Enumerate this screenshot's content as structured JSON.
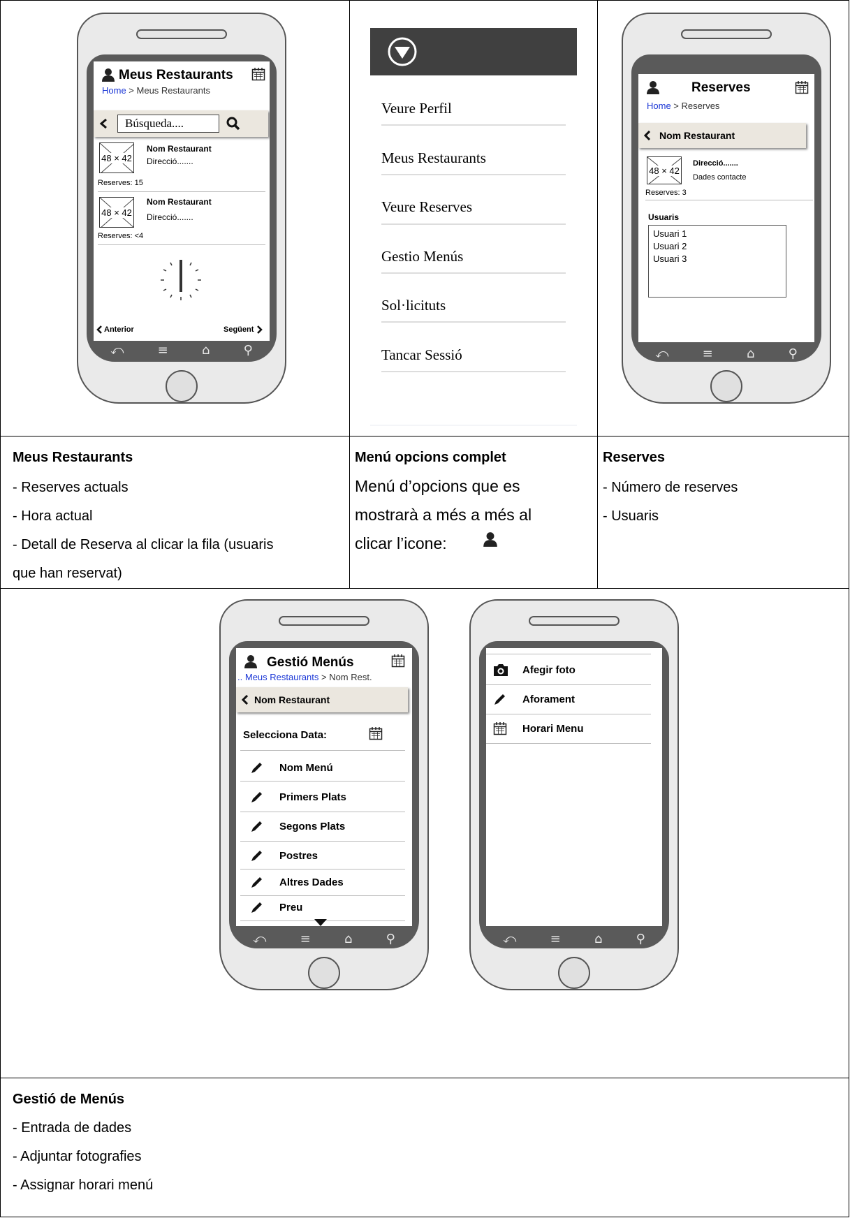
{
  "panel1": {
    "title": "Meus Restaurants",
    "crumb_home": "Home",
    "crumb_sep": " > ",
    "crumb_current": "Meus Restaurants",
    "search_value": "Búsqueda....",
    "items": [
      {
        "name": "Nom Restaurant",
        "addr": "Direcció.......",
        "img": "48 × 42",
        "reserves": "Reserves: 15"
      },
      {
        "name": "Nom Restaurant",
        "addr": "Direcció.......",
        "img": "48 × 42",
        "reserves": "Reserves: <4"
      }
    ],
    "prev_label": "Anterior",
    "next_label": "Següent"
  },
  "panel2": {
    "items": [
      "Veure Perfil",
      "Meus Restaurants",
      "Veure Reserves",
      "Gestio Menús",
      "Sol·licituts",
      "Tancar Sessió"
    ]
  },
  "panel3": {
    "title": "Reserves",
    "crumb_home": "Home",
    "crumb_sep": " > ",
    "crumb_current": "Reserves",
    "bar_label": "Nom Restaurant",
    "img": "48 × 42",
    "addr": "Direcció.......",
    "contact": "Dades contacte",
    "reserves": "Reserves: 3",
    "users_label": "Usuaris",
    "users": [
      "Usuari 1",
      "Usuari 2",
      "Usuari 3"
    ]
  },
  "desc1": {
    "title": "Meus Restaurants",
    "lines": [
      "-  Reserves actuals",
      "-  Hora actual",
      "-  Detall de Reserva al clicar la fila (usuaris",
      "que han reservat)"
    ]
  },
  "desc2": {
    "title": "Menú opcions complet",
    "lines": [
      "Menú d’opcions que es",
      "mostrarà a més a més al",
      "clicar l’icone:"
    ]
  },
  "desc3": {
    "title": "Reserves",
    "lines": [
      "-  Número de reserves",
      "-  Usuaris"
    ]
  },
  "panel4": {
    "title": "Gestió Menús",
    "crumb_prefix": "..",
    "crumb_link": "Meus Restaurants",
    "crumb_sep": " > ",
    "crumb_current": "Nom Rest.",
    "bar_label": "Nom Restaurant",
    "date_label": "Selecciona Data:",
    "items": [
      "Nom Menú",
      "Primers Plats",
      "Segons Plats",
      "Postres",
      "Altres Dades",
      "Preu"
    ]
  },
  "panel5": {
    "items": [
      "Afegir foto",
      "Aforament",
      "Horari Menu"
    ]
  },
  "desc4": {
    "title": "Gestió de Menús",
    "lines": [
      "-  Entrada de dades",
      "-  Adjuntar fotografies",
      "-  Assignar horari menú"
    ]
  },
  "nav_icons": [
    "back-icon",
    "menu-icon",
    "home-icon",
    "search-icon"
  ],
  "colors": {
    "link": "#1a36d6",
    "bezel": "#5a5a5a",
    "bar": "#ebe7df",
    "menu_header": "#404040"
  }
}
